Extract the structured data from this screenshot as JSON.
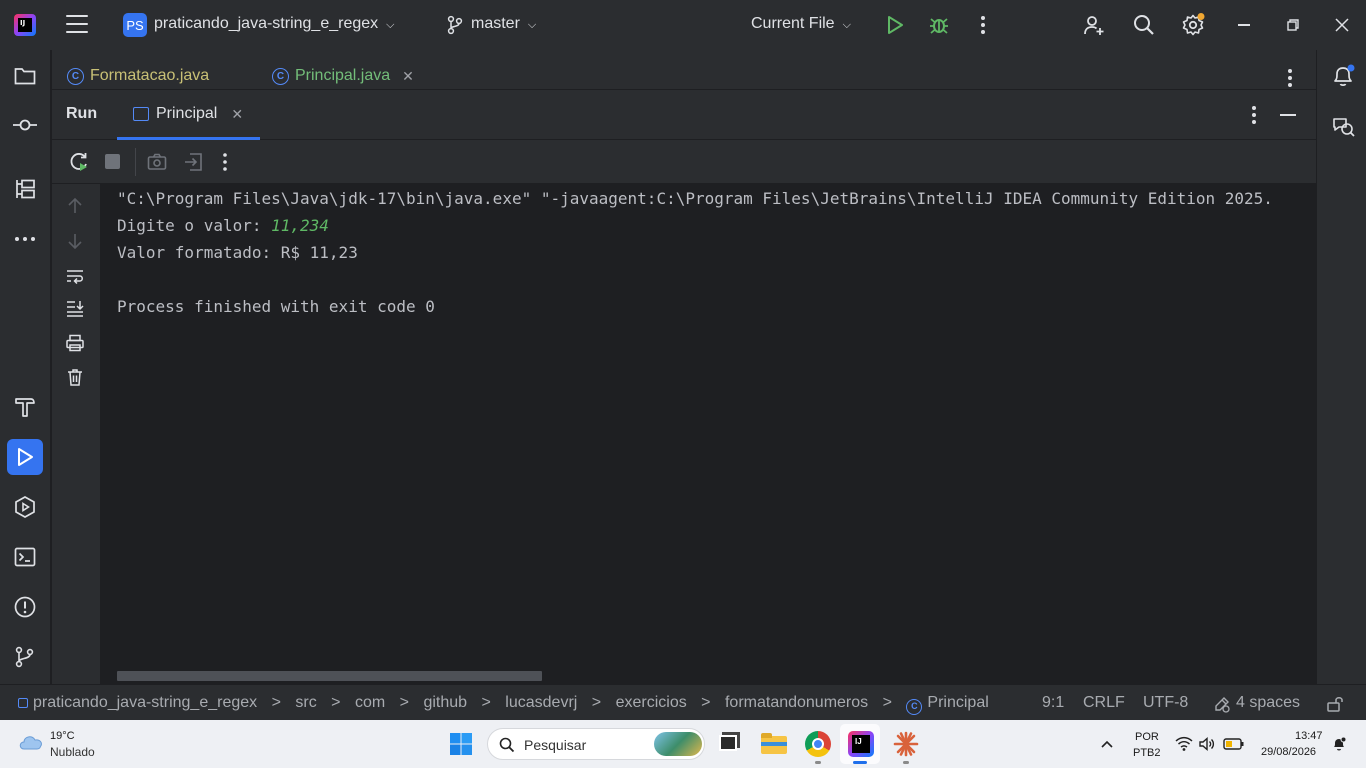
{
  "titlebar": {
    "logo_text": "IJ",
    "project_badge": "PS",
    "project_name": "praticando_java-string_e_regex",
    "branch": "master",
    "run_config": "Current File"
  },
  "editor_tabs": [
    {
      "label": "Formatacao.java"
    },
    {
      "label": "Principal.java"
    }
  ],
  "run_window": {
    "title": "Run",
    "tab_label": "Principal"
  },
  "console": {
    "line1": "\"C:\\Program Files\\Java\\jdk-17\\bin\\java.exe\" \"-javaagent:C:\\Program Files\\JetBrains\\IntelliJ IDEA Community Edition 2025.",
    "line2_prompt": "Digite o valor: ",
    "line2_input": "11,234",
    "line3": "Valor formatado: R$ 11,23",
    "line5": "Process finished with exit code 0"
  },
  "statusbar": {
    "breadcrumbs": [
      "praticando_java-string_e_regex",
      "src",
      "com",
      "github",
      "lucasdevrj",
      "exercicios",
      "formatandonumeros",
      "Principal"
    ],
    "separator": ">",
    "position": "9:1",
    "line_sep": "CRLF",
    "encoding": "UTF-8",
    "indent": "4 spaces"
  },
  "taskbar": {
    "weather_temp": "19°C",
    "weather_desc": "Nublado",
    "search_placeholder": "Pesquisar",
    "lang_top": "POR",
    "lang_bottom": "PTB2",
    "time": "13:47",
    "date": "29/08/2026"
  },
  "colors": {
    "accent": "#3574f0",
    "run_green": "#5fb865",
    "notification_dot": "#f0a732",
    "background": "#1e1f22",
    "panel": "#2b2d30"
  }
}
